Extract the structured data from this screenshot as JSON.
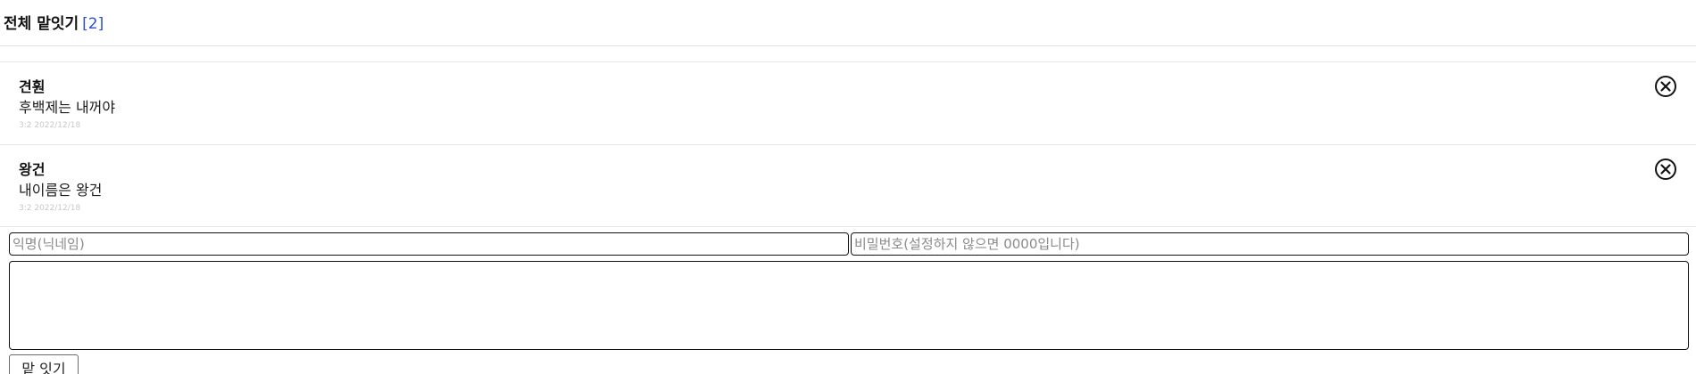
{
  "header": {
    "title": "전체 맡잇기",
    "count": "[2]",
    "count_color": "#2d4fcf"
  },
  "comments": [
    {
      "author": "견훤",
      "text": "후백제는 내꺼야",
      "meta": "3:2 2022/12/18",
      "delete_icon": "circle-x-icon"
    },
    {
      "author": "왕건",
      "text": "내이름은 왕건",
      "meta": "3:2 2022/12/18",
      "delete_icon": "circle-x-icon"
    }
  ],
  "form": {
    "name_placeholder": "익명(닉네임)",
    "name_value": "",
    "password_placeholder": "비밀번호(설정하지 않으면 0000입니다)",
    "password_value": "",
    "body_value": "",
    "submit_label": "맡 잇기"
  }
}
